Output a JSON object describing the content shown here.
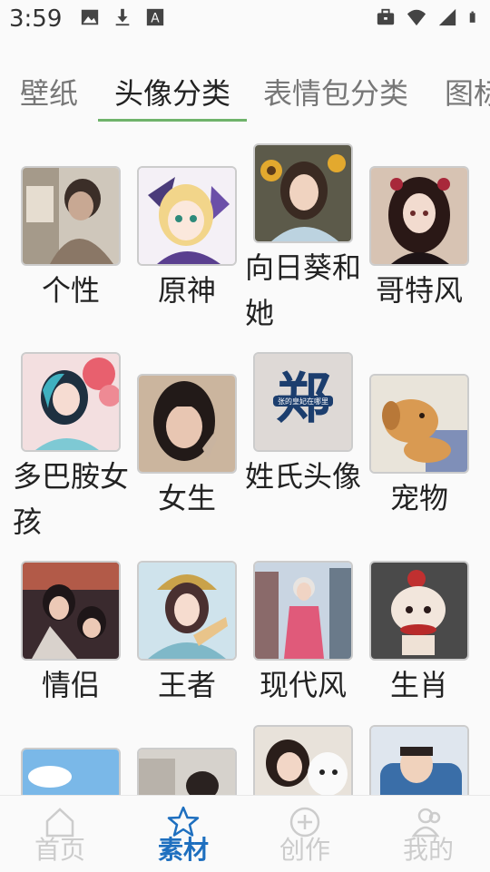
{
  "status_bar": {
    "time": "3:59",
    "left_icons": [
      "image-icon",
      "download-icon",
      "font-icon"
    ],
    "right_icons": [
      "briefcase-icon",
      "wifi-icon",
      "signal-icon",
      "battery-icon"
    ]
  },
  "tabs": [
    {
      "label": "壁纸",
      "active": false
    },
    {
      "label": "头像分类",
      "active": true
    },
    {
      "label": "表情包分类",
      "active": false
    },
    {
      "label": "图标",
      "active": false
    }
  ],
  "categories": [
    {
      "label": "个性",
      "image": "moody-boy-photo"
    },
    {
      "label": "原神",
      "image": "anime-girl-illustration"
    },
    {
      "label": "向日葵和她",
      "image": "girl-with-sunflowers"
    },
    {
      "label": "哥特风",
      "image": "gothic-girl"
    },
    {
      "label": "多巴胺女孩",
      "image": "girl-with-balloons"
    },
    {
      "label": "女生",
      "image": "girl-selfie"
    },
    {
      "label": "姓氏头像",
      "image": "surname-calligraphy"
    },
    {
      "label": "宠物",
      "image": "golden-puppy"
    },
    {
      "label": "情侣",
      "image": "anime-couple"
    },
    {
      "label": "王者",
      "image": "game-heroine"
    },
    {
      "label": "现代风",
      "image": "city-street-girl"
    },
    {
      "label": "生肖",
      "image": "zodiac-creature"
    },
    {
      "label": "",
      "image": "sky-boy"
    },
    {
      "label": "",
      "image": "boy-masked"
    },
    {
      "label": "",
      "image": "girl-with-dog"
    },
    {
      "label": "",
      "image": "baby-in-car"
    }
  ],
  "thumb_text": {
    "surname": "郑",
    "surname_caption": "张的皇妃在哪里"
  },
  "bottom_nav": [
    {
      "label": "首页",
      "icon": "home-icon",
      "active": false
    },
    {
      "label": "素材",
      "icon": "star-icon",
      "active": true
    },
    {
      "label": "创作",
      "icon": "plus-circle-icon",
      "active": false
    },
    {
      "label": "我的",
      "icon": "users-icon",
      "active": false
    }
  ],
  "colors": {
    "tab_underline": "#6fb36a",
    "nav_active": "#1e6fbf",
    "nav_inactive": "#cccccc"
  }
}
